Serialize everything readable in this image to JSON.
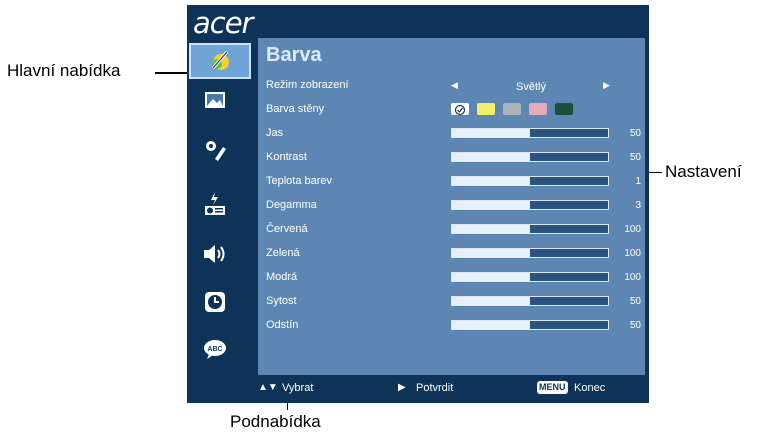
{
  "logo": "acer",
  "menu": {
    "title": "Barva",
    "rows": [
      {
        "label": "Režim zobrazení",
        "type": "selector",
        "value": "Světlý"
      },
      {
        "label": "Barva stěny",
        "type": "swatches"
      },
      {
        "label": "Jas",
        "type": "slider",
        "value": "50",
        "level": 0.5
      },
      {
        "label": "Kontrast",
        "type": "slider",
        "value": "50",
        "level": 0.5
      },
      {
        "label": "Teplota barev",
        "type": "slider",
        "value": "1",
        "level": 0.5
      },
      {
        "label": "Degamma",
        "type": "slider",
        "value": "3",
        "level": 0.5
      },
      {
        "label": "Červená",
        "type": "slider",
        "value": "100",
        "level": 0.5
      },
      {
        "label": "Zelená",
        "type": "slider",
        "value": "100",
        "level": 0.5
      },
      {
        "label": "Modrá",
        "type": "slider",
        "value": "100",
        "level": 0.5
      },
      {
        "label": "Sytost",
        "type": "slider",
        "value": "50",
        "level": 0.5
      },
      {
        "label": "Odstín",
        "type": "slider",
        "value": "50",
        "level": 0.5
      }
    ],
    "wall_colors": [
      "#ffffff",
      "#f2ee6a",
      "#a8b4b8",
      "#e8aabb",
      "#1f4f3a"
    ]
  },
  "sidebar_icons": [
    "color-icon",
    "image-icon",
    "settings-icon",
    "management-icon",
    "audio-icon",
    "timer-icon",
    "language-icon"
  ],
  "footer": {
    "select": "Vybrat",
    "confirm": "Potvrdit",
    "menu_key": "MENU",
    "exit": "Konec"
  },
  "callouts": {
    "main_menu": "Hlavní nabídka",
    "settings": "Nastavení",
    "submenu": "Podnabídka"
  },
  "colors": {
    "osd_frame": "#0f3358",
    "panel": "#5d87b2",
    "active_tab": "#6fa3d6"
  }
}
